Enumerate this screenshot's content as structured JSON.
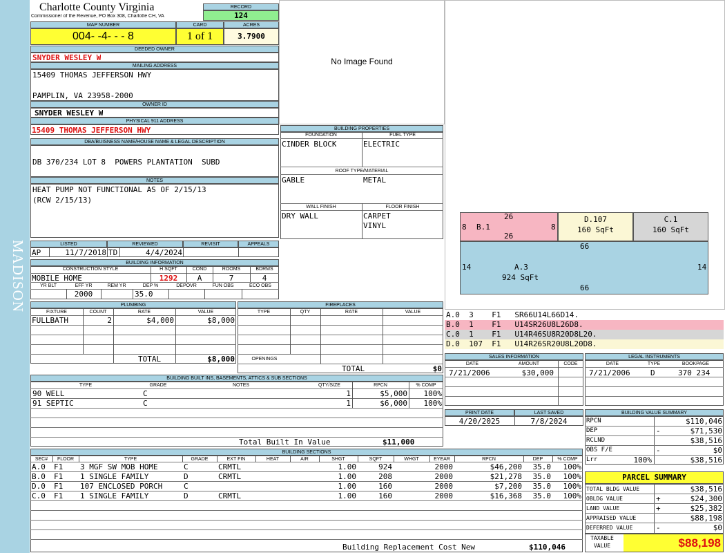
{
  "county": {
    "title": "Charlotte County Virginia",
    "subtitle": "Commissioner of the Revenue, PO Box 308, Charlotte CH, VA"
  },
  "side_label": "MADISON",
  "record": {
    "label": "RECORD",
    "value": "124"
  },
  "map_number": {
    "label": "MAP NUMBER",
    "value": "004- -4- - - 8"
  },
  "card": {
    "label": "CARD",
    "value": "1 of 1"
  },
  "acres": {
    "label": "ACRES",
    "value": "3.7900"
  },
  "deeded_owner": {
    "label": "DEEDED OWNER",
    "value": "SNYDER WESLEY W"
  },
  "mailing_address": {
    "label": "MAILING ADDRESS",
    "line1": "15409 THOMAS JEFFERSON HWY",
    "line2": "PAMPLIN, VA 23958-2000"
  },
  "owner_id": {
    "label": "OWNER ID",
    "value": "SNYDER WESLEY W"
  },
  "physical_address": {
    "label": "PHYSICAL 911 ADDRESS",
    "value": "15409 THOMAS JEFFERSON HWY"
  },
  "dba": {
    "label": "DBA/BUISNESS NAME/HOUSE NAME & LEGAL DESCRIPTION",
    "value": "DB 370/234 LOT 8  POWERS PLANTATION  SUBD"
  },
  "notes": {
    "label": "NOTES",
    "line1": "HEAT PUMP NOT FUNCTIONAL AS OF 2/15/13",
    "line2": "(RCW 2/15/13)"
  },
  "image_placeholder": "No Image Found",
  "listed": {
    "headers": [
      "LISTED",
      "REVIEWED",
      "REVISIT",
      "APPEALS"
    ],
    "listed_by": "AP",
    "listed_date": "11/7/2018",
    "reviewed_by": "TD",
    "reviewed_date": "4/4/2024",
    "revisit": "",
    "appeals": ""
  },
  "building_info": {
    "label": "BUILDING INFORMATION",
    "headers": [
      "CONSTRUCTION STYLE",
      "H SQFT",
      "COND",
      "ROOMS",
      "BDRMS"
    ],
    "style": "MOBILE HOME",
    "hsqft": "1292",
    "cond": "A",
    "rooms": "7",
    "bdrms": "4",
    "headers2": [
      "YR BLT",
      "EFF YR",
      "REM YR",
      "DEP %",
      "DEPOVR",
      "FUN OBS",
      "ECO OBS"
    ],
    "yr_blt": "",
    "eff_yr": "2000",
    "rem_yr": "",
    "dep": "35.0",
    "depovr": "",
    "fun_obs": "",
    "eco_obs": ""
  },
  "building_properties": {
    "label": "BUILDING PROPERTIES",
    "foundation_label": "FOUNDATION",
    "fuel_label": "FUEL TYPE",
    "foundation": "CINDER BLOCK",
    "fuel": "ELECTRIC",
    "roof_label": "ROOF TYPE/MATERIAL",
    "roof_type": "GABLE",
    "roof_material": "METAL",
    "wall_label": "WALL FINISH",
    "floor_label": "FLOOR FINISH",
    "wall": "DRY WALL",
    "floor1": "CARPET",
    "floor2": "VINYL"
  },
  "plumbing": {
    "label": "PLUMBING",
    "headers": [
      "FIXTURE",
      "COUNT",
      "RATE",
      "VALUE"
    ],
    "rows": [
      {
        "fixture": "FULLBATH",
        "count": "2",
        "rate": "$4,000",
        "value": "$8,000"
      }
    ],
    "total_label": "TOTAL",
    "total": "$8,000"
  },
  "fireplaces": {
    "label": "FIREPLACES",
    "headers": [
      "TYPE",
      "QTY",
      "RATE",
      "VALUE"
    ],
    "openings_label": "OPENINGS",
    "total_label": "TOTAL",
    "total": "$0"
  },
  "built_ins": {
    "label": "BUILDING BUILT INS, BASEMENTS, ATTICS & SUB SECTIONS",
    "headers": [
      "TYPE",
      "GRADE",
      "NOTES",
      "QTY/SIZE",
      "RPCN",
      "% COMP"
    ],
    "rows": [
      {
        "type": "90 WELL",
        "grade": "C",
        "notes": "",
        "qty": "1",
        "rpcn": "$5,000",
        "comp": "100%"
      },
      {
        "type": "91 SEPTIC",
        "grade": "C",
        "notes": "",
        "qty": "1",
        "rpcn": "$6,000",
        "comp": "100%"
      }
    ],
    "total_label": "Total Built In Value",
    "total": "$11,000"
  },
  "sketch": {
    "sections": [
      {
        "id": "B.1",
        "area": "",
        "top": "26",
        "bottom": "26",
        "left": "8",
        "right": "8",
        "color": "#f7b6c2"
      },
      {
        "id": "D.107",
        "area": "160 SqFt",
        "color": "#fbf7d5"
      },
      {
        "id": "C.1",
        "area": "160 SqFt",
        "color": "#d6d6d6"
      },
      {
        "id": "A.3",
        "area": "924 SqFt",
        "top": "66",
        "bottom": "66",
        "left": "14",
        "right": "14",
        "color": "#a9d3e3"
      }
    ]
  },
  "sketch_codes": [
    {
      "text": "A.0  3    F1   SR66U14L66D14.",
      "color": "#ffffff"
    },
    {
      "text": "B.0  1    F1   U14SR26U8L26D8.",
      "color": "#f7b6c2"
    },
    {
      "text": "C.0  1    F1   U14R46SU8R20D8L20.",
      "color": "#d6d6d6"
    },
    {
      "text": "D.0  107  F1   U14R26SR20U8L20D8.",
      "color": "#fbf7d5"
    }
  ],
  "sales": {
    "label": "SALES INFORMATION",
    "headers": [
      "DATE",
      "AMOUNT",
      "CODE"
    ],
    "rows": [
      {
        "date": "7/21/2006",
        "amount": "$30,000",
        "code": ""
      }
    ]
  },
  "legal": {
    "label": "LEGAL INSTRUMENTS",
    "headers": [
      "DATE",
      "TYPE",
      "BOOKPAGE"
    ],
    "rows": [
      {
        "date": "7/21/2006",
        "type": "D",
        "bookpage": "370 234"
      }
    ]
  },
  "print_info": {
    "print_label": "PRINT DATE",
    "saved_label": "LAST SAVED",
    "print_date": "4/20/2025",
    "last_saved": "7/8/2024"
  },
  "value_summary": {
    "label": "BUILDING VALUE SUMMARY",
    "rows": [
      {
        "label": "RPCN",
        "sign": "",
        "value": "$110,046"
      },
      {
        "label": "DEP",
        "sign": "-",
        "value": "$71,530"
      },
      {
        "label": "RCLND",
        "sign": "",
        "value": "$38,516"
      },
      {
        "label": "OBS F/E",
        "sign": "-",
        "value": "$0"
      },
      {
        "label": "Lrr",
        "pct": "100%",
        "sign": "",
        "value": "$38,516"
      }
    ]
  },
  "parcel_summary": {
    "label": "PARCEL SUMMARY",
    "rows": [
      {
        "label": "TOTAL BLDG VALUE",
        "sign": "",
        "value": "$38,516"
      },
      {
        "label": "OBLDG VALUE",
        "sign": "+",
        "value": "$24,300"
      },
      {
        "label": "LAND VALUE",
        "sign": "+",
        "value": "$25,382"
      },
      {
        "label": "APPRAISED VALUE",
        "sign": "",
        "value": "$88,198"
      },
      {
        "label": "DEFERRED VALUE",
        "sign": "-",
        "value": "$0"
      }
    ],
    "taxable_label1": "TAXABLE",
    "taxable_label2": "VALUE",
    "taxable": "$88,198"
  },
  "building_sections": {
    "label": "BUILDING SECTIONS",
    "headers": [
      "SEC#",
      "FLOOR",
      "TYPE",
      "GRADE",
      "EXT FIN",
      "HEAT",
      "AIR",
      "SHGT",
      "SQFT",
      "WHGT",
      "EYEAR",
      "RPCN",
      "DEP",
      "% COMP"
    ],
    "rows": [
      {
        "sec": "A.0",
        "floor": "F1",
        "type": "3 MGF SW MOB HOME",
        "grade": "C",
        "ext": "CRMTL",
        "heat": "",
        "air": "",
        "shgt": "1.00",
        "sqft": "924",
        "whgt": "",
        "eyear": "2000",
        "rpcn": "$46,200",
        "dep": "35.0",
        "comp": "100%"
      },
      {
        "sec": "B.0",
        "floor": "F1",
        "type": "1 SINGLE FAMILY",
        "grade": "D",
        "ext": "CRMTL",
        "heat": "",
        "air": "",
        "shgt": "1.00",
        "sqft": "208",
        "whgt": "",
        "eyear": "2000",
        "rpcn": "$21,278",
        "dep": "35.0",
        "comp": "100%"
      },
      {
        "sec": "D.0",
        "floor": "F1",
        "type": "107 ENCLOSED PORCH",
        "grade": "C",
        "ext": "",
        "heat": "",
        "air": "",
        "shgt": "1.00",
        "sqft": "160",
        "whgt": "",
        "eyear": "2000",
        "rpcn": "$7,200",
        "dep": "35.0",
        "comp": "100%"
      },
      {
        "sec": "C.0",
        "floor": "F1",
        "type": "1 SINGLE FAMILY",
        "grade": "D",
        "ext": "CRMTL",
        "heat": "",
        "air": "",
        "shgt": "1.00",
        "sqft": "160",
        "whgt": "",
        "eyear": "2000",
        "rpcn": "$16,368",
        "dep": "35.0",
        "comp": "100%"
      }
    ],
    "total_label": "Building Replacement Cost New",
    "total": "$110,046"
  },
  "colors": {
    "header_blue": "#a9d3e3",
    "yellow": "#ffff33",
    "green": "#90ee90",
    "red": "#dd1111"
  }
}
